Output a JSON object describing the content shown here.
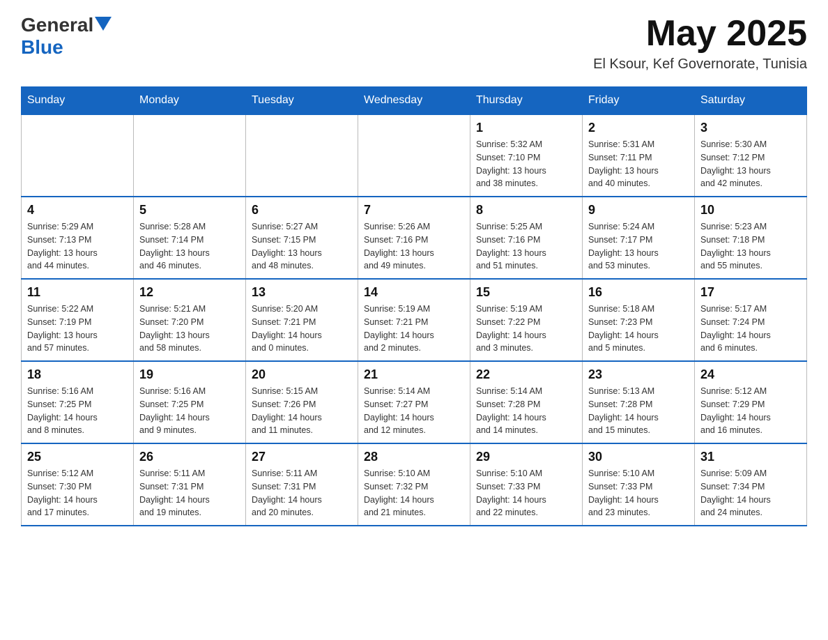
{
  "header": {
    "logo_general": "General",
    "logo_blue": "Blue",
    "title": "May 2025",
    "location": "El Ksour, Kef Governorate, Tunisia"
  },
  "calendar": {
    "days_of_week": [
      "Sunday",
      "Monday",
      "Tuesday",
      "Wednesday",
      "Thursday",
      "Friday",
      "Saturday"
    ],
    "weeks": [
      [
        {
          "day": "",
          "info": ""
        },
        {
          "day": "",
          "info": ""
        },
        {
          "day": "",
          "info": ""
        },
        {
          "day": "",
          "info": ""
        },
        {
          "day": "1",
          "info": "Sunrise: 5:32 AM\nSunset: 7:10 PM\nDaylight: 13 hours\nand 38 minutes."
        },
        {
          "day": "2",
          "info": "Sunrise: 5:31 AM\nSunset: 7:11 PM\nDaylight: 13 hours\nand 40 minutes."
        },
        {
          "day": "3",
          "info": "Sunrise: 5:30 AM\nSunset: 7:12 PM\nDaylight: 13 hours\nand 42 minutes."
        }
      ],
      [
        {
          "day": "4",
          "info": "Sunrise: 5:29 AM\nSunset: 7:13 PM\nDaylight: 13 hours\nand 44 minutes."
        },
        {
          "day": "5",
          "info": "Sunrise: 5:28 AM\nSunset: 7:14 PM\nDaylight: 13 hours\nand 46 minutes."
        },
        {
          "day": "6",
          "info": "Sunrise: 5:27 AM\nSunset: 7:15 PM\nDaylight: 13 hours\nand 48 minutes."
        },
        {
          "day": "7",
          "info": "Sunrise: 5:26 AM\nSunset: 7:16 PM\nDaylight: 13 hours\nand 49 minutes."
        },
        {
          "day": "8",
          "info": "Sunrise: 5:25 AM\nSunset: 7:16 PM\nDaylight: 13 hours\nand 51 minutes."
        },
        {
          "day": "9",
          "info": "Sunrise: 5:24 AM\nSunset: 7:17 PM\nDaylight: 13 hours\nand 53 minutes."
        },
        {
          "day": "10",
          "info": "Sunrise: 5:23 AM\nSunset: 7:18 PM\nDaylight: 13 hours\nand 55 minutes."
        }
      ],
      [
        {
          "day": "11",
          "info": "Sunrise: 5:22 AM\nSunset: 7:19 PM\nDaylight: 13 hours\nand 57 minutes."
        },
        {
          "day": "12",
          "info": "Sunrise: 5:21 AM\nSunset: 7:20 PM\nDaylight: 13 hours\nand 58 minutes."
        },
        {
          "day": "13",
          "info": "Sunrise: 5:20 AM\nSunset: 7:21 PM\nDaylight: 14 hours\nand 0 minutes."
        },
        {
          "day": "14",
          "info": "Sunrise: 5:19 AM\nSunset: 7:21 PM\nDaylight: 14 hours\nand 2 minutes."
        },
        {
          "day": "15",
          "info": "Sunrise: 5:19 AM\nSunset: 7:22 PM\nDaylight: 14 hours\nand 3 minutes."
        },
        {
          "day": "16",
          "info": "Sunrise: 5:18 AM\nSunset: 7:23 PM\nDaylight: 14 hours\nand 5 minutes."
        },
        {
          "day": "17",
          "info": "Sunrise: 5:17 AM\nSunset: 7:24 PM\nDaylight: 14 hours\nand 6 minutes."
        }
      ],
      [
        {
          "day": "18",
          "info": "Sunrise: 5:16 AM\nSunset: 7:25 PM\nDaylight: 14 hours\nand 8 minutes."
        },
        {
          "day": "19",
          "info": "Sunrise: 5:16 AM\nSunset: 7:25 PM\nDaylight: 14 hours\nand 9 minutes."
        },
        {
          "day": "20",
          "info": "Sunrise: 5:15 AM\nSunset: 7:26 PM\nDaylight: 14 hours\nand 11 minutes."
        },
        {
          "day": "21",
          "info": "Sunrise: 5:14 AM\nSunset: 7:27 PM\nDaylight: 14 hours\nand 12 minutes."
        },
        {
          "day": "22",
          "info": "Sunrise: 5:14 AM\nSunset: 7:28 PM\nDaylight: 14 hours\nand 14 minutes."
        },
        {
          "day": "23",
          "info": "Sunrise: 5:13 AM\nSunset: 7:28 PM\nDaylight: 14 hours\nand 15 minutes."
        },
        {
          "day": "24",
          "info": "Sunrise: 5:12 AM\nSunset: 7:29 PM\nDaylight: 14 hours\nand 16 minutes."
        }
      ],
      [
        {
          "day": "25",
          "info": "Sunrise: 5:12 AM\nSunset: 7:30 PM\nDaylight: 14 hours\nand 17 minutes."
        },
        {
          "day": "26",
          "info": "Sunrise: 5:11 AM\nSunset: 7:31 PM\nDaylight: 14 hours\nand 19 minutes."
        },
        {
          "day": "27",
          "info": "Sunrise: 5:11 AM\nSunset: 7:31 PM\nDaylight: 14 hours\nand 20 minutes."
        },
        {
          "day": "28",
          "info": "Sunrise: 5:10 AM\nSunset: 7:32 PM\nDaylight: 14 hours\nand 21 minutes."
        },
        {
          "day": "29",
          "info": "Sunrise: 5:10 AM\nSunset: 7:33 PM\nDaylight: 14 hours\nand 22 minutes."
        },
        {
          "day": "30",
          "info": "Sunrise: 5:10 AM\nSunset: 7:33 PM\nDaylight: 14 hours\nand 23 minutes."
        },
        {
          "day": "31",
          "info": "Sunrise: 5:09 AM\nSunset: 7:34 PM\nDaylight: 14 hours\nand 24 minutes."
        }
      ]
    ]
  }
}
